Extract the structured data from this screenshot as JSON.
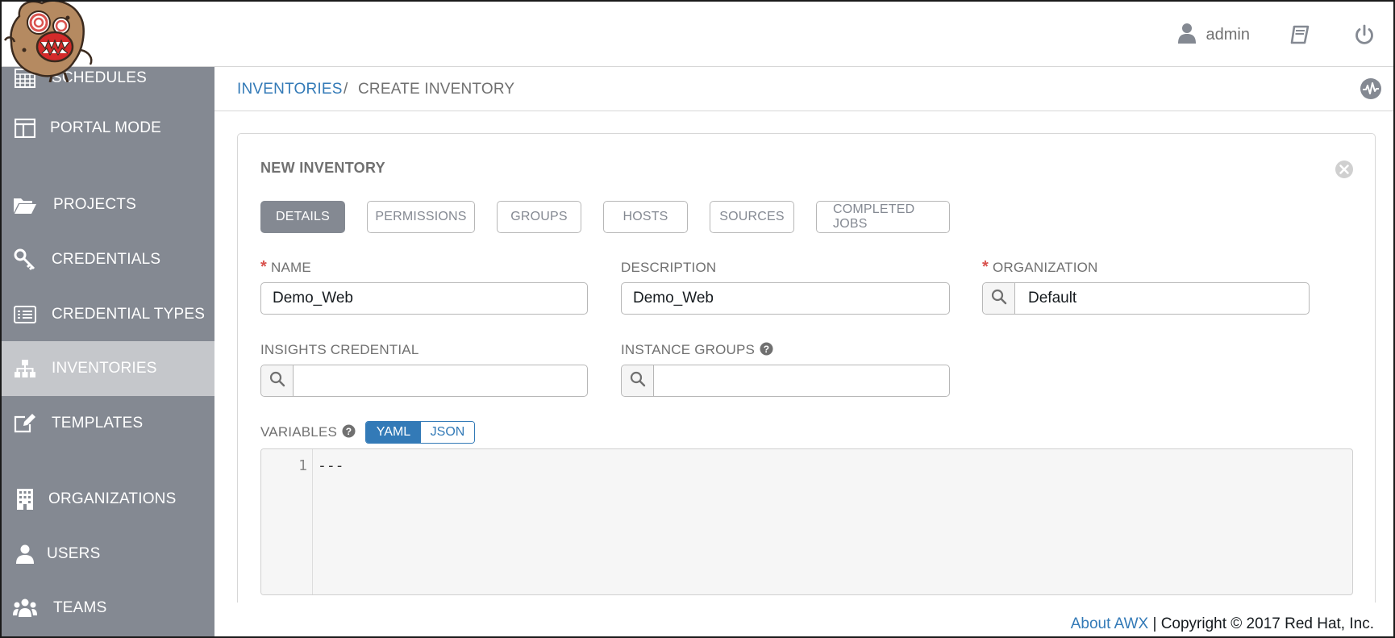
{
  "header": {
    "user_name": "admin",
    "icons": [
      "user-icon",
      "docs-book-icon",
      "power-logout-icon"
    ]
  },
  "sidebar": {
    "items": [
      {
        "label": "SCHEDULES",
        "icon": "calendar-grid-icon"
      },
      {
        "label": "PORTAL MODE",
        "icon": "columns-icon"
      },
      {
        "label": "PROJECTS",
        "icon": "folder-open-icon"
      },
      {
        "label": "CREDENTIALS",
        "icon": "key-icon"
      },
      {
        "label": "CREDENTIAL TYPES",
        "icon": "list-card-icon"
      },
      {
        "label": "INVENTORIES",
        "icon": "sitemap-icon",
        "active": true
      },
      {
        "label": "TEMPLATES",
        "icon": "edit-icon"
      },
      {
        "label": "ORGANIZATIONS",
        "icon": "building-icon"
      },
      {
        "label": "USERS",
        "icon": "user-icon"
      },
      {
        "label": "TEAMS",
        "icon": "users-group-icon"
      }
    ]
  },
  "breadcrumb": {
    "parent": "INVENTORIES",
    "separator": "/",
    "current": "CREATE INVENTORY"
  },
  "panel": {
    "title": "NEW INVENTORY",
    "tabs": [
      {
        "label": "DETAILS",
        "active": true
      },
      {
        "label": "PERMISSIONS"
      },
      {
        "label": "GROUPS"
      },
      {
        "label": "HOSTS"
      },
      {
        "label": "SOURCES"
      },
      {
        "label": "COMPLETED JOBS"
      }
    ]
  },
  "form": {
    "name": {
      "label": "NAME",
      "required": true,
      "value": "Demo_Web"
    },
    "description": {
      "label": "DESCRIPTION",
      "value": "Demo_Web"
    },
    "organization": {
      "label": "ORGANIZATION",
      "required": true,
      "value": "Default"
    },
    "insights_credential": {
      "label": "INSIGHTS CREDENTIAL",
      "value": ""
    },
    "instance_groups": {
      "label": "INSTANCE GROUPS",
      "value": ""
    },
    "variables": {
      "label": "VARIABLES",
      "mode_yaml": "YAML",
      "mode_json": "JSON",
      "selected_mode": "YAML",
      "line_number": "1",
      "content": "---"
    }
  },
  "footer": {
    "link": "About AWX",
    "separator": " | ",
    "copyright": "Copyright © 2017 Red Hat, Inc."
  },
  "colors": {
    "sidebar_bg": "#848992",
    "sidebar_active": "#c5c7cb",
    "link_blue": "#337ab7",
    "required_red": "#d9534f"
  }
}
